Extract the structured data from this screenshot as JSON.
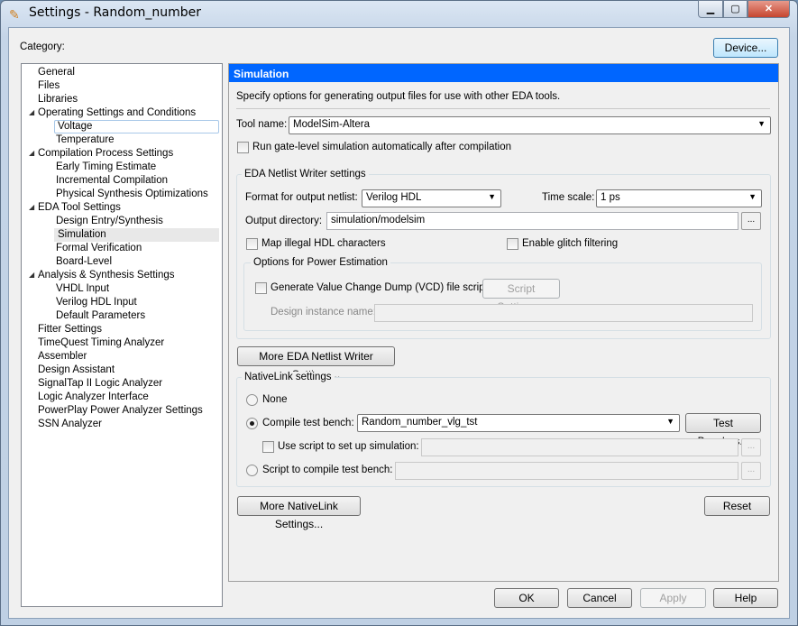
{
  "window": {
    "title": "Settings - Random_number",
    "minimize": "▁",
    "maximize": "▢",
    "close": "✕"
  },
  "category_label": "Category:",
  "device_button": "Device...",
  "tree": [
    {
      "label": "General",
      "level": 0
    },
    {
      "label": "Files",
      "level": 0
    },
    {
      "label": "Libraries",
      "level": 0
    },
    {
      "label": "Operating Settings and Conditions",
      "level": 0,
      "expanded": true
    },
    {
      "label": "Voltage",
      "level": 1
    },
    {
      "label": "Temperature",
      "level": 1
    },
    {
      "label": "Compilation Process Settings",
      "level": 0,
      "expanded": true
    },
    {
      "label": "Early Timing Estimate",
      "level": 1
    },
    {
      "label": "Incremental Compilation",
      "level": 1
    },
    {
      "label": "Physical Synthesis Optimizations",
      "level": 1
    },
    {
      "label": "EDA Tool Settings",
      "level": 0,
      "expanded": true
    },
    {
      "label": "Design Entry/Synthesis",
      "level": 1
    },
    {
      "label": "Simulation",
      "level": 1,
      "selected": true
    },
    {
      "label": "Formal Verification",
      "level": 1
    },
    {
      "label": "Board-Level",
      "level": 1
    },
    {
      "label": "Analysis & Synthesis Settings",
      "level": 0,
      "expanded": true
    },
    {
      "label": "VHDL Input",
      "level": 1
    },
    {
      "label": "Verilog HDL Input",
      "level": 1
    },
    {
      "label": "Default Parameters",
      "level": 1
    },
    {
      "label": "Fitter Settings",
      "level": 0
    },
    {
      "label": "TimeQuest Timing Analyzer",
      "level": 0
    },
    {
      "label": "Assembler",
      "level": 0
    },
    {
      "label": "Design Assistant",
      "level": 0
    },
    {
      "label": "SignalTap II Logic Analyzer",
      "level": 0
    },
    {
      "label": "Logic Analyzer Interface",
      "level": 0
    },
    {
      "label": "PowerPlay Power Analyzer Settings",
      "level": 0
    },
    {
      "label": "SSN Analyzer",
      "level": 0
    }
  ],
  "panel": {
    "header": "Simulation",
    "description": "Specify options for generating output files for use with other EDA tools.",
    "tool_name_label": "Tool name:",
    "tool_name": "ModelSim-Altera",
    "run_gate_level": "Run gate-level simulation automatically after compilation",
    "eda": {
      "title": "EDA Netlist Writer settings",
      "format_label": "Format for output netlist:",
      "format": "Verilog HDL",
      "timescale_label": "Time scale:",
      "timescale": "1 ps",
      "outdir_label": "Output directory:",
      "outdir": "simulation/modelsim",
      "browse": "...",
      "map_illegal": "Map illegal HDL characters",
      "glitch": "Enable glitch filtering",
      "power": {
        "title": "Options for Power Estimation",
        "vcd": "Generate Value Change Dump (VCD) file script",
        "script_settings": "Script Settings...",
        "instance_label": "Design instance name:",
        "instance": ""
      }
    },
    "more_eda": "More EDA Netlist Writer Settings...",
    "nativelink": {
      "title": "NativeLink settings",
      "none": "None",
      "compile_tb": "Compile test bench:",
      "testbench": "Random_number_vlg_tst",
      "test_benches": "Test Benches...",
      "use_script": "Use script to set up simulation:",
      "script_compile": "Script to compile test bench:",
      "browse": "..."
    },
    "more_nativelink": "More NativeLink Settings...",
    "reset": "Reset"
  },
  "buttons": {
    "ok": "OK",
    "cancel": "Cancel",
    "apply": "Apply",
    "help": "Help"
  }
}
